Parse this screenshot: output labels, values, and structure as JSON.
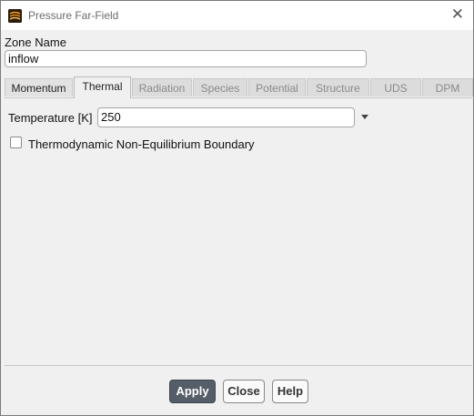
{
  "window": {
    "title": "Pressure Far-Field",
    "close_glyph": "✕",
    "icon": "fluent-app-icon"
  },
  "zone": {
    "label": "Zone Name",
    "value": "inflow"
  },
  "tabs": [
    {
      "label": "Momentum",
      "state": "enabled"
    },
    {
      "label": "Thermal",
      "state": "active"
    },
    {
      "label": "Radiation",
      "state": "disabled"
    },
    {
      "label": "Species",
      "state": "disabled"
    },
    {
      "label": "Potential",
      "state": "disabled"
    },
    {
      "label": "Structure",
      "state": "disabled"
    },
    {
      "label": "UDS",
      "state": "disabled"
    },
    {
      "label": "DPM",
      "state": "disabled"
    }
  ],
  "thermal": {
    "temperature_label": "Temperature [K]",
    "temperature_value": "250",
    "checkbox_label": "Thermodynamic Non-Equilibrium Boundary",
    "checkbox_checked": false
  },
  "buttons": {
    "apply": "Apply",
    "close": "Close",
    "help": "Help"
  },
  "colors": {
    "primary_button": "#555d68",
    "window_bg": "#f0f0f0"
  }
}
